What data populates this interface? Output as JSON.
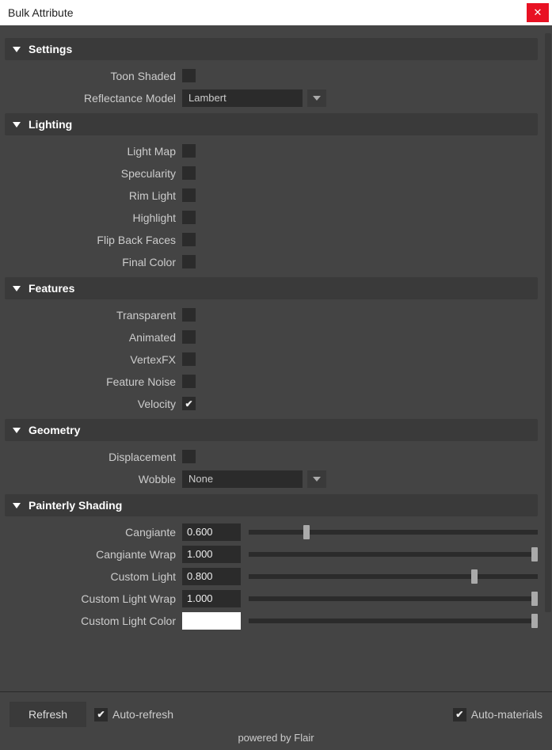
{
  "window": {
    "title": "Bulk Attribute"
  },
  "sections": {
    "settings": {
      "title": "Settings",
      "toon_shaded": {
        "label": "Toon Shaded",
        "checked": false
      },
      "reflectance_model": {
        "label": "Reflectance Model",
        "value": "Lambert"
      }
    },
    "lighting": {
      "title": "Lighting",
      "items": [
        {
          "label": "Light Map",
          "checked": false
        },
        {
          "label": "Specularity",
          "checked": false
        },
        {
          "label": "Rim Light",
          "checked": false
        },
        {
          "label": "Highlight",
          "checked": false
        },
        {
          "label": "Flip Back Faces",
          "checked": false
        },
        {
          "label": "Final Color",
          "checked": false
        }
      ]
    },
    "features": {
      "title": "Features",
      "items": [
        {
          "label": "Transparent",
          "checked": false
        },
        {
          "label": "Animated",
          "checked": false
        },
        {
          "label": "VertexFX",
          "checked": false
        },
        {
          "label": "Feature Noise",
          "checked": false
        },
        {
          "label": "Velocity",
          "checked": true
        }
      ]
    },
    "geometry": {
      "title": "Geometry",
      "displacement": {
        "label": "Displacement",
        "checked": false
      },
      "wobble": {
        "label": "Wobble",
        "value": "None"
      }
    },
    "painterly": {
      "title": "Painterly Shading",
      "sliders": [
        {
          "label": "Cangiante",
          "value": "0.600",
          "pct": 20
        },
        {
          "label": "Cangiante Wrap",
          "value": "1.000",
          "pct": 99
        },
        {
          "label": "Custom Light",
          "value": "0.800",
          "pct": 78
        },
        {
          "label": "Custom Light Wrap",
          "value": "1.000",
          "pct": 99
        }
      ],
      "color": {
        "label": "Custom Light Color",
        "value": "#ffffff",
        "pct": 99
      }
    }
  },
  "footer": {
    "refresh": "Refresh",
    "auto_refresh": {
      "label": "Auto-refresh",
      "checked": true
    },
    "auto_materials": {
      "label": "Auto-materials",
      "checked": true
    },
    "powered": "powered by Flair"
  }
}
